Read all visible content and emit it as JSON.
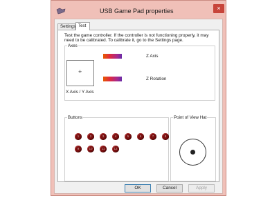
{
  "window": {
    "title": "USB Game Pad  properties",
    "close_glyph": "×"
  },
  "tabs": [
    {
      "label": "Settings"
    },
    {
      "label": "Test"
    }
  ],
  "instructions": "Test the game controller.  If the controller is not functioning properly, it may need to be calibrated.  To calibrate it, go to the Settings page.",
  "axes": {
    "group_label": "Axes",
    "xy_label": "X Axis / Y Axis",
    "xy_marker": "+",
    "z_label": "Z Axis",
    "z_rotation_label": "Z Rotation"
  },
  "buttons": {
    "group_label": "Buttons",
    "items": [
      "1",
      "2",
      "3",
      "4",
      "5",
      "6",
      "7",
      "8",
      "9",
      "10",
      "11",
      "12"
    ]
  },
  "pov": {
    "group_label": "Point of View Hat"
  },
  "dialog_buttons": {
    "ok": "OK",
    "cancel": "Cancel",
    "apply": "Apply"
  },
  "colors": {
    "title_bar": "#f0c0b8",
    "close_button": "#c7443a",
    "button_indicator": "#7a0f0f",
    "axis_bar_gradient": [
      "#e65a00",
      "#e02b3e",
      "#a62a8e",
      "#6a2ca8"
    ]
  }
}
